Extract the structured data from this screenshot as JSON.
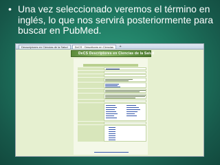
{
  "slide": {
    "bullet": "•",
    "text": "Una vez seleccionado veremos el término en inglés, lo que nos servirá posteriormente para buscar en PubMed."
  },
  "browser": {
    "tabs": [
      {
        "label": "Decscriptores en Ciencias de la Salud",
        "active": false
      },
      {
        "label": "DeCS - Descritores en Ciencias",
        "active": true
      }
    ],
    "new_tab_label": "+"
  },
  "decs": {
    "banner_title": "DeCS  Descriptores en Ciencias de la Salud"
  },
  "colors": {
    "slide_bg": "#1f7a62",
    "page_bg": "#e6f0d0",
    "banner": "#6b9d4a",
    "link": "#3355aa"
  }
}
